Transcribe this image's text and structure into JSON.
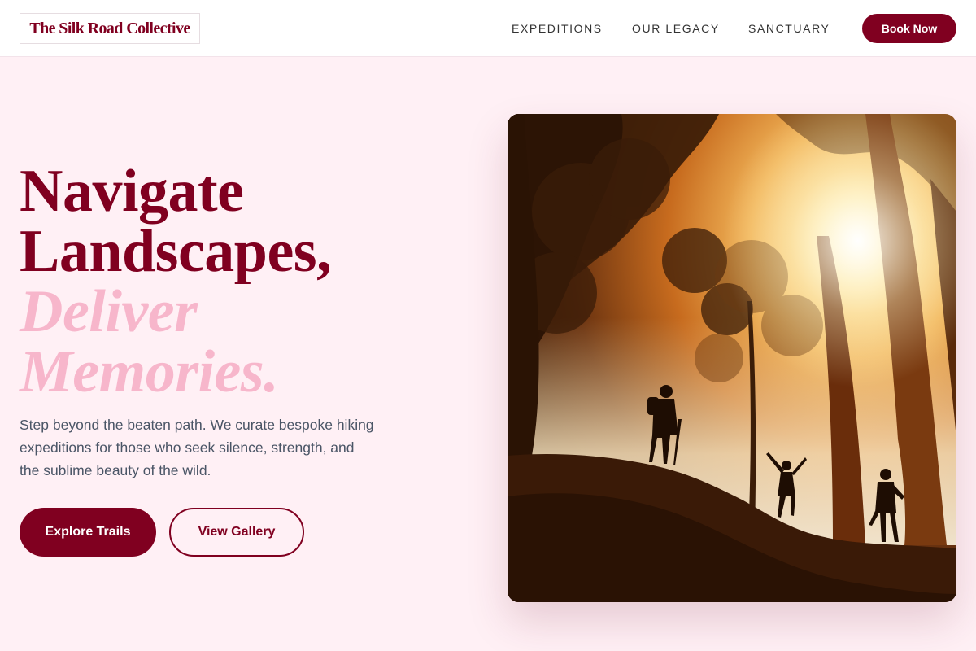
{
  "brand": {
    "name": "The Silk Road Collective",
    "color": "#800020",
    "accent": "#f7b6cb",
    "background": "#fff0f5"
  },
  "nav": {
    "links": [
      "EXPEDITIONS",
      "OUR LEGACY",
      "SANCTUARY"
    ],
    "cta": "Book Now"
  },
  "hero": {
    "headline_lines": [
      "Navigate",
      "Landscapes,"
    ],
    "headline_accent_lines": [
      "Deliver",
      "Memories."
    ],
    "description": "Step beyond the beaten path. We curate bespoke hiking expeditions for those who seek silence, strength, and the sublime beauty of the wild.",
    "primary_cta": "Explore Trails",
    "secondary_cta": "View Gallery",
    "image": {
      "subject": "silhouetted hikers among tall trees at sunset",
      "icon": "photo-icon"
    }
  }
}
